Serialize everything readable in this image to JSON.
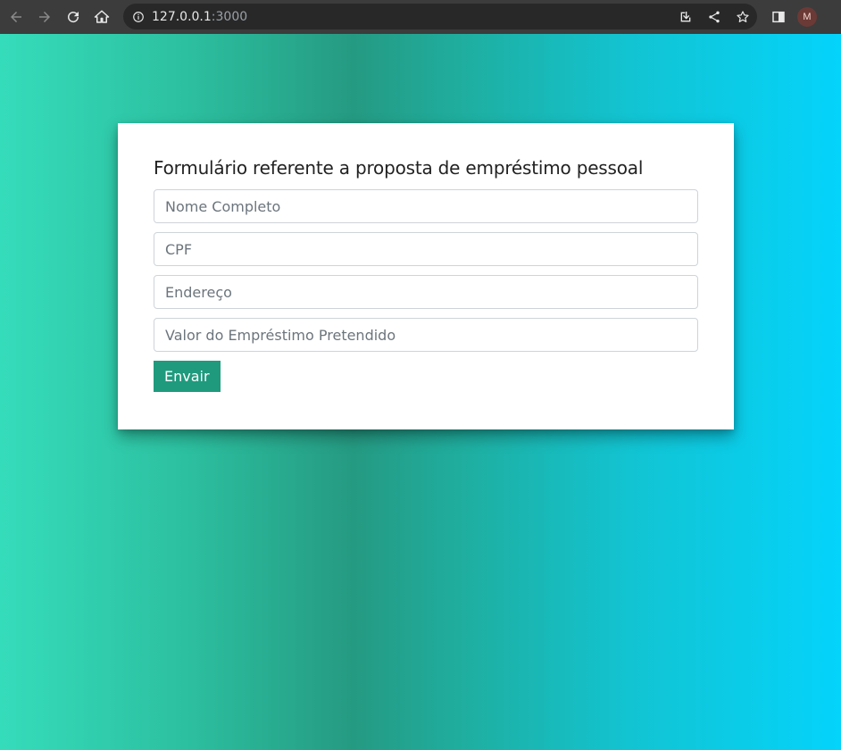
{
  "browser": {
    "url_host": "127.0.0.1",
    "url_port": ":3000",
    "profile_initial": "M"
  },
  "form": {
    "title": "Formulário referente a proposta de empréstimo pessoal",
    "fields": [
      {
        "placeholder": "Nome Completo",
        "value": ""
      },
      {
        "placeholder": "CPF",
        "value": ""
      },
      {
        "placeholder": "Endereço",
        "value": ""
      },
      {
        "placeholder": "Valor do Empréstimo Pretendido",
        "value": ""
      }
    ],
    "submit_label": "Envair"
  },
  "colors": {
    "submit_bg": "#1f9a7d",
    "gradient_left": "#35dcbb",
    "gradient_mid": "#259a82",
    "gradient_right": "#04d3fb"
  }
}
